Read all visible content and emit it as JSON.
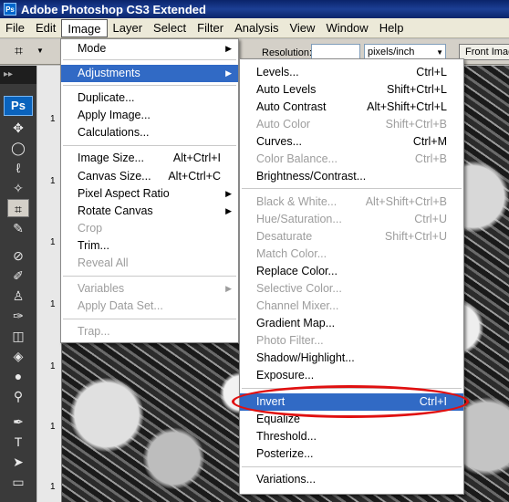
{
  "window": {
    "title": "Adobe Photoshop CS3 Extended",
    "logo_text": "Ps"
  },
  "menubar": {
    "items": [
      "File",
      "Edit",
      "Image",
      "Layer",
      "Select",
      "Filter",
      "Analysis",
      "View",
      "Window",
      "Help"
    ]
  },
  "options": {
    "resolution_label": "Resolution:",
    "resolution_value": "",
    "units": "pixels/inch",
    "front_image_label": "Front Imag"
  },
  "toolbox": {
    "badge": "Ps",
    "header": "▸▸"
  },
  "image_menu": {
    "items": [
      {
        "label": "Mode",
        "shortcut": "",
        "submenu": true,
        "disabled": false
      },
      {
        "label": "Adjustments",
        "shortcut": "",
        "submenu": true,
        "disabled": false,
        "highlighted": true
      },
      {
        "label": "Duplicate...",
        "shortcut": "",
        "submenu": false,
        "disabled": false
      },
      {
        "label": "Apply Image...",
        "shortcut": "",
        "submenu": false,
        "disabled": false
      },
      {
        "label": "Calculations...",
        "shortcut": "",
        "submenu": false,
        "disabled": false
      },
      {
        "label": "Image Size...",
        "shortcut": "Alt+Ctrl+I",
        "submenu": false,
        "disabled": false
      },
      {
        "label": "Canvas Size...",
        "shortcut": "Alt+Ctrl+C",
        "submenu": false,
        "disabled": false
      },
      {
        "label": "Pixel Aspect Ratio",
        "shortcut": "",
        "submenu": true,
        "disabled": false
      },
      {
        "label": "Rotate Canvas",
        "shortcut": "",
        "submenu": true,
        "disabled": false
      },
      {
        "label": "Crop",
        "shortcut": "",
        "submenu": false,
        "disabled": true
      },
      {
        "label": "Trim...",
        "shortcut": "",
        "submenu": false,
        "disabled": false
      },
      {
        "label": "Reveal All",
        "shortcut": "",
        "submenu": false,
        "disabled": true
      },
      {
        "label": "Variables",
        "shortcut": "",
        "submenu": true,
        "disabled": true
      },
      {
        "label": "Apply Data Set...",
        "shortcut": "",
        "submenu": false,
        "disabled": true
      },
      {
        "label": "Trap...",
        "shortcut": "",
        "submenu": false,
        "disabled": true
      }
    ]
  },
  "adjustments_menu": {
    "items": [
      {
        "label": "Levels...",
        "shortcut": "Ctrl+L",
        "disabled": false
      },
      {
        "label": "Auto Levels",
        "shortcut": "Shift+Ctrl+L",
        "disabled": false
      },
      {
        "label": "Auto Contrast",
        "shortcut": "Alt+Shift+Ctrl+L",
        "disabled": false
      },
      {
        "label": "Auto Color",
        "shortcut": "Shift+Ctrl+B",
        "disabled": true
      },
      {
        "label": "Curves...",
        "shortcut": "Ctrl+M",
        "disabled": false
      },
      {
        "label": "Color Balance...",
        "shortcut": "Ctrl+B",
        "disabled": true
      },
      {
        "label": "Brightness/Contrast...",
        "shortcut": "",
        "disabled": false
      },
      {
        "label": "Black & White...",
        "shortcut": "Alt+Shift+Ctrl+B",
        "disabled": true
      },
      {
        "label": "Hue/Saturation...",
        "shortcut": "Ctrl+U",
        "disabled": true
      },
      {
        "label": "Desaturate",
        "shortcut": "Shift+Ctrl+U",
        "disabled": true
      },
      {
        "label": "Match Color...",
        "shortcut": "",
        "disabled": true
      },
      {
        "label": "Replace Color...",
        "shortcut": "",
        "disabled": false
      },
      {
        "label": "Selective Color...",
        "shortcut": "",
        "disabled": true
      },
      {
        "label": "Channel Mixer...",
        "shortcut": "",
        "disabled": true
      },
      {
        "label": "Gradient Map...",
        "shortcut": "",
        "disabled": false
      },
      {
        "label": "Photo Filter...",
        "shortcut": "",
        "disabled": true
      },
      {
        "label": "Shadow/Highlight...",
        "shortcut": "",
        "disabled": false
      },
      {
        "label": "Exposure...",
        "shortcut": "",
        "disabled": false
      },
      {
        "label": "Invert",
        "shortcut": "Ctrl+I",
        "disabled": false,
        "highlighted": true
      },
      {
        "label": "Equalize",
        "shortcut": "",
        "disabled": false
      },
      {
        "label": "Threshold...",
        "shortcut": "",
        "disabled": false
      },
      {
        "label": "Posterize...",
        "shortcut": "",
        "disabled": false
      },
      {
        "label": "Variations...",
        "shortcut": "",
        "disabled": false
      }
    ]
  },
  "ruler": {
    "marks": [
      "1",
      "1",
      "1",
      "1",
      "1",
      "1",
      "1"
    ]
  },
  "colors": {
    "highlight": "#316ac5",
    "disabled_text": "#9d9d9d",
    "annotation_ring": "#e01010"
  }
}
